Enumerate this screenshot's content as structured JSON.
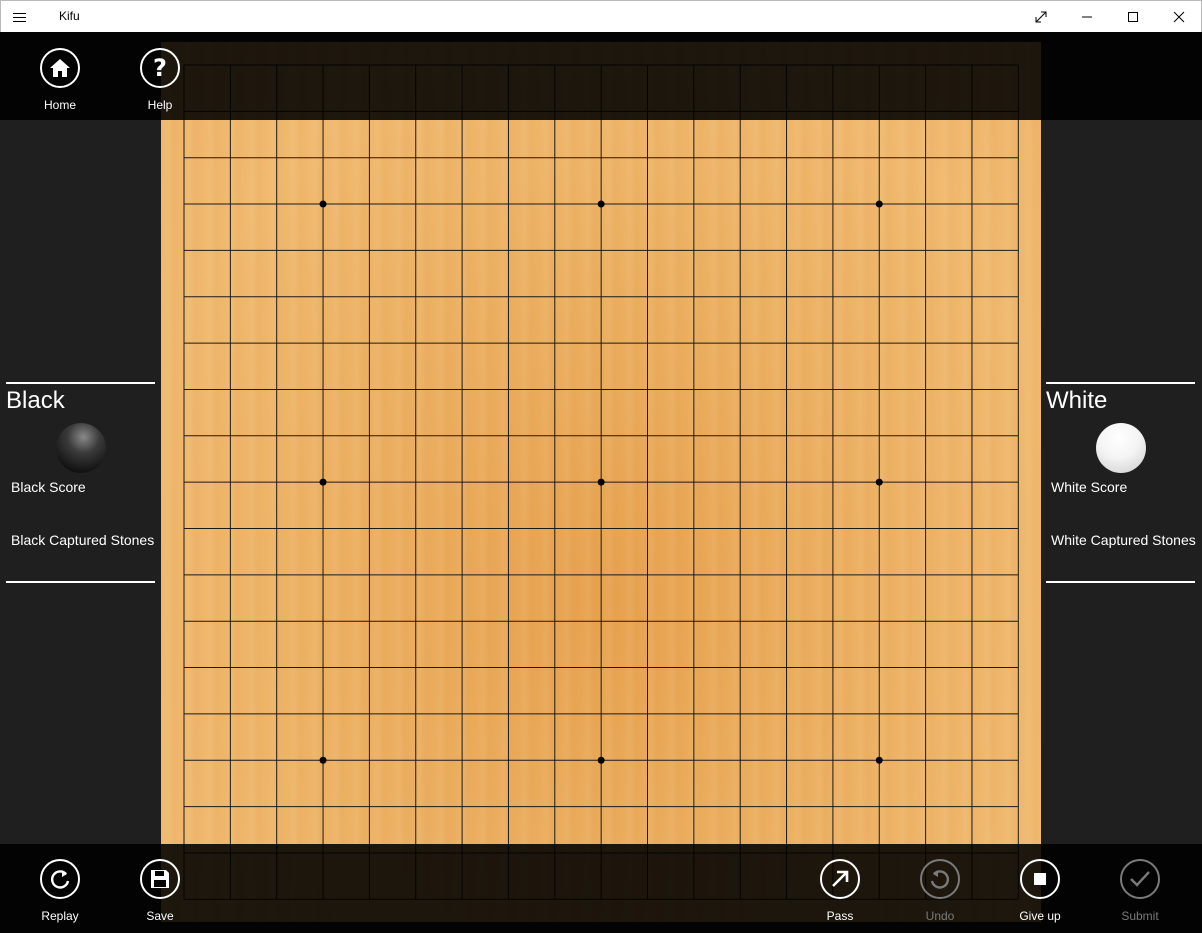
{
  "window": {
    "title": "Kifu",
    "menu_icon": "hamburger-icon",
    "controls": [
      "restore-icon",
      "minimize-icon",
      "maximize-icon",
      "close-icon"
    ]
  },
  "top_bar": {
    "home_label": "Home",
    "help_label": "Help"
  },
  "bottom_bar": {
    "replay_label": "Replay",
    "save_label": "Save",
    "pass_label": "Pass",
    "undo_label": "Undo",
    "give_up_label": "Give up",
    "submit_label": "Submit"
  },
  "black_player": {
    "name": "Black",
    "score_label": "Black Score",
    "captured_label": "Black Captured Stones"
  },
  "white_player": {
    "name": "White",
    "score_label": "White Score",
    "captured_label": "White Captured Stones"
  },
  "board": {
    "size": 19,
    "star_points": [
      [
        3,
        3
      ],
      [
        3,
        9
      ],
      [
        3,
        15
      ],
      [
        9,
        3
      ],
      [
        9,
        9
      ],
      [
        9,
        15
      ],
      [
        15,
        3
      ],
      [
        15,
        9
      ],
      [
        15,
        15
      ]
    ],
    "stones": []
  },
  "colors": {
    "accent": "#ffffff",
    "disabled": "#7a7a7a",
    "board": "#f0b96f",
    "grid": "#1a1a1a"
  }
}
